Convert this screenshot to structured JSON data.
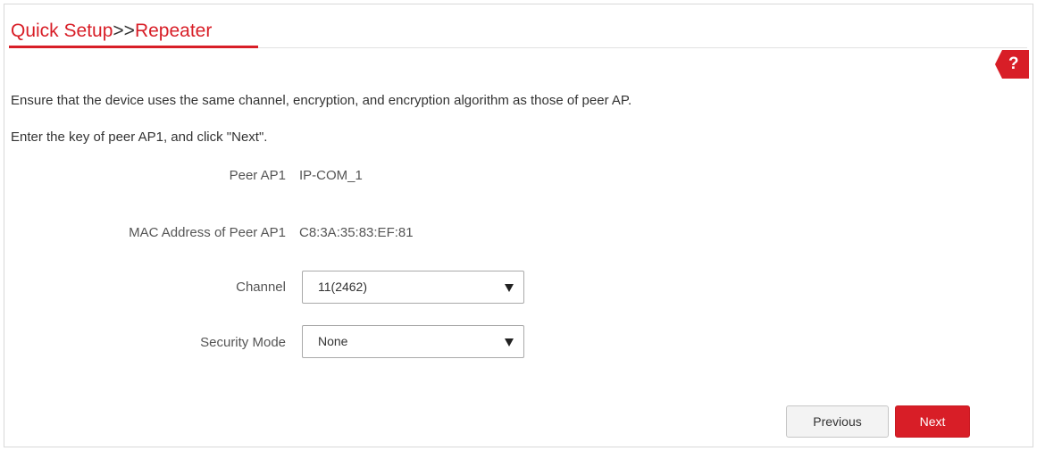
{
  "title": {
    "part1": "Quick Setup",
    "separator": ">>",
    "part2": "Repeater"
  },
  "help": {
    "icon_label": "?",
    "icon": "help-icon",
    "color": "#d81e27"
  },
  "instructions": {
    "line1": "Ensure that the device uses the same channel, encryption, and encryption algorithm as those of peer AP.",
    "line2": "Enter the key of peer AP1, and click \"Next\"."
  },
  "fields": {
    "peer_ap": {
      "label": "Peer AP1",
      "value": "IP-COM_1"
    },
    "mac": {
      "label": "MAC Address of Peer AP1",
      "value": "C8:3A:35:83:EF:81"
    },
    "channel": {
      "label": "Channel",
      "value": "11(2462)"
    },
    "security_mode": {
      "label": "Security Mode",
      "value": "None"
    }
  },
  "buttons": {
    "previous": "Previous",
    "next": "Next"
  },
  "colors": {
    "accent": "#d81e27"
  }
}
